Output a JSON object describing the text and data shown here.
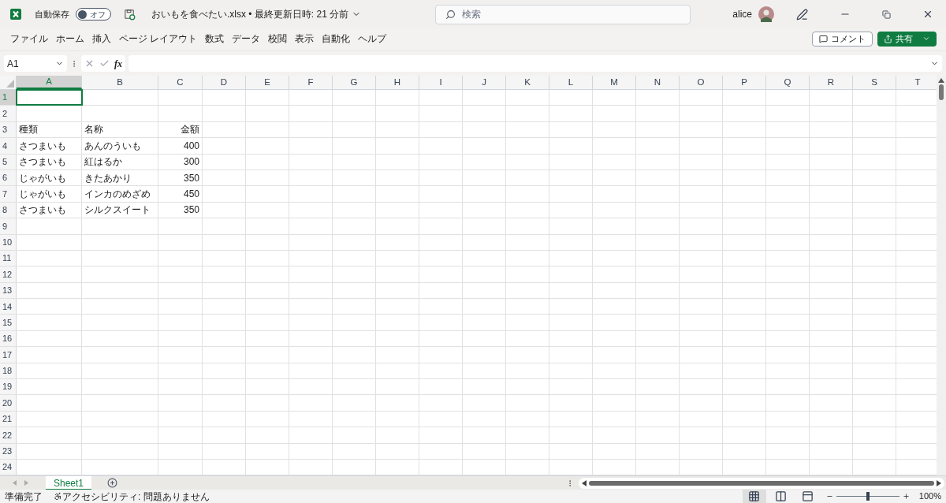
{
  "title_bar": {
    "autosave_label": "自動保存",
    "autosave": {
      "on": false,
      "label": "オフ"
    },
    "document_title": "おいもを食べたい.xlsx • 最終更新日時: 21 分前",
    "search": {
      "placeholder": "検索"
    },
    "user_name": "alice"
  },
  "menu": [
    {
      "label": "ファイル"
    },
    {
      "label": "ホーム"
    },
    {
      "label": "挿入"
    },
    {
      "label": "ページ レイアウト"
    },
    {
      "label": "数式"
    },
    {
      "label": "データ"
    },
    {
      "label": "校閲"
    },
    {
      "label": "表示"
    },
    {
      "label": "自動化"
    },
    {
      "label": "ヘルプ"
    }
  ],
  "comment_button": "コメント",
  "share_button": "共有",
  "formula_bar": {
    "name_box": "A1",
    "fx": "fx"
  },
  "columns": [
    {
      "label": "A",
      "selected": true,
      "kind": "text"
    },
    {
      "label": "B",
      "selected": false,
      "kind": "text"
    },
    {
      "label": "C",
      "selected": false,
      "kind": "number"
    },
    {
      "label": "D",
      "selected": false,
      "kind": "text"
    },
    {
      "label": "E",
      "selected": false,
      "kind": "text"
    },
    {
      "label": "F",
      "selected": false,
      "kind": "text"
    },
    {
      "label": "G",
      "selected": false,
      "kind": "text"
    },
    {
      "label": "H",
      "selected": false,
      "kind": "text"
    },
    {
      "label": "I",
      "selected": false,
      "kind": "text"
    },
    {
      "label": "J",
      "selected": false,
      "kind": "text"
    },
    {
      "label": "K",
      "selected": false,
      "kind": "text"
    },
    {
      "label": "L",
      "selected": false,
      "kind": "text"
    },
    {
      "label": "M",
      "selected": false,
      "kind": "text"
    },
    {
      "label": "N",
      "selected": false,
      "kind": "text"
    },
    {
      "label": "O",
      "selected": false,
      "kind": "text"
    },
    {
      "label": "P",
      "selected": false,
      "kind": "text"
    },
    {
      "label": "Q",
      "selected": false,
      "kind": "text"
    },
    {
      "label": "R",
      "selected": false,
      "kind": "text"
    },
    {
      "label": "S",
      "selected": false,
      "kind": "text"
    },
    {
      "label": "T",
      "selected": false,
      "kind": "text"
    }
  ],
  "rows": [
    {
      "number": "1",
      "selected": true
    },
    {
      "number": "2",
      "selected": false
    },
    {
      "number": "3",
      "selected": false,
      "cells": [
        "種類",
        "名称",
        "金額"
      ]
    },
    {
      "number": "4",
      "selected": false,
      "cells": [
        "さつまいも",
        "あんのういも",
        "400"
      ]
    },
    {
      "number": "5",
      "selected": false,
      "cells": [
        "さつまいも",
        "紅はるか",
        "300"
      ]
    },
    {
      "number": "6",
      "selected": false,
      "cells": [
        "じゃがいも",
        "きたあかり",
        "350"
      ]
    },
    {
      "number": "7",
      "selected": false,
      "cells": [
        "じゃがいも",
        "インカのめざめ",
        "450"
      ]
    },
    {
      "number": "8",
      "selected": false,
      "cells": [
        "さつまいも",
        "シルクスイート",
        "350"
      ]
    },
    {
      "number": "9",
      "selected": false
    },
    {
      "number": "10",
      "selected": false
    },
    {
      "number": "11",
      "selected": false
    },
    {
      "number": "12",
      "selected": false
    },
    {
      "number": "13",
      "selected": false
    },
    {
      "number": "14",
      "selected": false
    },
    {
      "number": "15",
      "selected": false
    },
    {
      "number": "16",
      "selected": false
    },
    {
      "number": "17",
      "selected": false
    },
    {
      "number": "18",
      "selected": false
    },
    {
      "number": "19",
      "selected": false
    },
    {
      "number": "20",
      "selected": false
    },
    {
      "number": "21",
      "selected": false
    },
    {
      "number": "22",
      "selected": false
    },
    {
      "number": "23",
      "selected": false
    },
    {
      "number": "24",
      "selected": false
    }
  ],
  "sheet_tabs": [
    {
      "label": "Sheet1",
      "selected": true
    }
  ],
  "status_bar": {
    "status": "準備完了",
    "accessibility": "アクセシビリティ: 問題ありません",
    "views": [
      {
        "kind": "normal",
        "selected": true
      },
      {
        "kind": "page_layout",
        "selected": false
      },
      {
        "kind": "page_break",
        "selected": false
      }
    ],
    "zoom": {
      "level": 0.5,
      "label": "100%"
    }
  }
}
